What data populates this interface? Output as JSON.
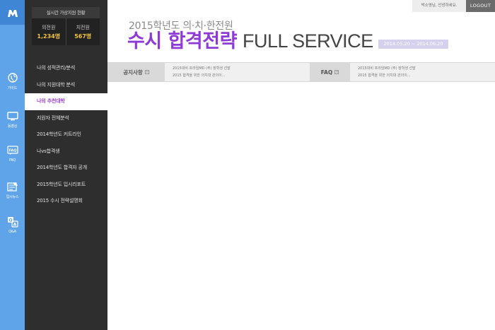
{
  "rail": {
    "logo_icon": "m-logo-icon",
    "items": [
      {
        "label": "가이드",
        "icon": "globe-icon"
      },
      {
        "label": "동영상",
        "icon": "monitor-icon"
      },
      {
        "label": "FAQ",
        "icon": "faq-icon"
      },
      {
        "label": "입시뉴스",
        "icon": "news-icon"
      },
      {
        "label": "Q&A",
        "icon": "qa-icon"
      }
    ]
  },
  "stats": {
    "title": "실시간 가상지원 현황",
    "items": [
      {
        "label": "의전원",
        "value": "1,234명"
      },
      {
        "label": "치전원",
        "value": "567명"
      }
    ]
  },
  "menu": {
    "items": [
      {
        "label": "나의 성적관리/분석",
        "active": false
      },
      {
        "label": "나의 지원대학 분석",
        "active": false
      },
      {
        "label": "나의 추천대학",
        "active": true
      },
      {
        "label": "지원자 전체분석",
        "active": false
      },
      {
        "label": "2014학년도 커트라인",
        "active": false
      },
      {
        "label": "나vs합격생",
        "active": false
      },
      {
        "label": "2014학년도 합격자 공개",
        "active": false
      },
      {
        "label": "2015학년도 입시리포트",
        "active": false
      },
      {
        "label": "2015 수시 전략설명회",
        "active": false
      }
    ]
  },
  "user": {
    "greeting": "박소영님, 안녕하세요.",
    "logout": "LOGOUT"
  },
  "header": {
    "subtitle": "2015학년도 의·치·한전원",
    "title_highlight": "수시 합격전략",
    "title_rest": "FULL SERVICE",
    "period": "2014.05.20 ~ 2014.06.20"
  },
  "notice": {
    "label": "공지사항",
    "items": [
      "2015대비 프라임MD (주) 장학생 선발",
      "2015 합격을 위한 의치대 관의이..."
    ]
  },
  "faq": {
    "label": "FAQ",
    "items": [
      "2015대비 프라임MD (주) 장학생 선발",
      "2015 합격을 위한 의치대 관의이..."
    ]
  },
  "colors": {
    "rail": "#5fa3e8",
    "menu_bg": "#2e2e2e",
    "accent": "#8e3ad6",
    "stat_value": "#f3c63a"
  }
}
